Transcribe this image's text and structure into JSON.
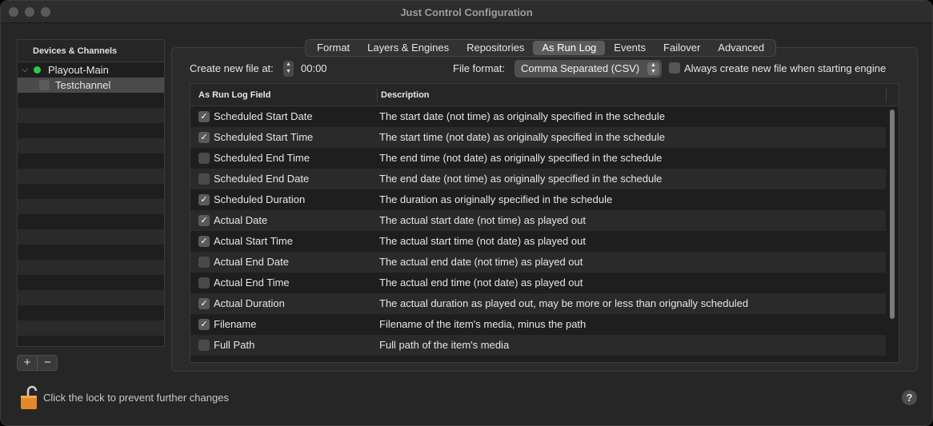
{
  "window": {
    "title": "Just Control Configuration"
  },
  "sidebar": {
    "header": "Devices & Channels",
    "device": {
      "name": "Playout-Main",
      "status_color": "#2fc94a"
    },
    "channel": {
      "name": "Testchannel"
    },
    "add_label": "+",
    "remove_label": "−"
  },
  "tabs": [
    "Format",
    "Layers & Engines",
    "Repositories",
    "As Run Log",
    "Events",
    "Failover",
    "Advanced"
  ],
  "active_tab": "As Run Log",
  "options": {
    "create_new_label": "Create new file at:",
    "create_time": "00:00",
    "format_label": "File format:",
    "format_value": "Comma Separated (CSV)",
    "always_new_label": "Always create new file when starting engine"
  },
  "table": {
    "columns": [
      "As Run Log Field",
      "Description"
    ],
    "rows": [
      {
        "field": "Scheduled Start Date",
        "checked": true,
        "description": "The start date (not time) as originally specified in the schedule"
      },
      {
        "field": "Scheduled Start Time",
        "checked": true,
        "description": "The start time (not date) as originally specified in the schedule"
      },
      {
        "field": "Scheduled End Time",
        "checked": false,
        "description": "The end time (not date) as originally specified in the schedule"
      },
      {
        "field": "Scheduled End Date",
        "checked": false,
        "description": "The end date (not time) as originally specified in the schedule"
      },
      {
        "field": "Scheduled Duration",
        "checked": true,
        "description": "The duration as originally specified in the schedule"
      },
      {
        "field": "Actual Date",
        "checked": true,
        "description": "The actual start date (not time) as played out"
      },
      {
        "field": "Actual Start Time",
        "checked": true,
        "description": "The actual start time (not date) as played out"
      },
      {
        "field": "Actual End Date",
        "checked": false,
        "description": "The actual end date (not time) as played out"
      },
      {
        "field": "Actual End Time",
        "checked": false,
        "description": "The actual end time (not date) as played out"
      },
      {
        "field": "Actual Duration",
        "checked": true,
        "description": "The actual duration as played out, may be more or less than orignally scheduled"
      },
      {
        "field": "Filename",
        "checked": true,
        "description": "Filename of the item's media, minus the path"
      },
      {
        "field": "Full Path",
        "checked": false,
        "description": "Full path of the item's media"
      }
    ]
  },
  "footer": {
    "lock_text": "Click the lock to prevent further changes",
    "help_label": "?"
  }
}
